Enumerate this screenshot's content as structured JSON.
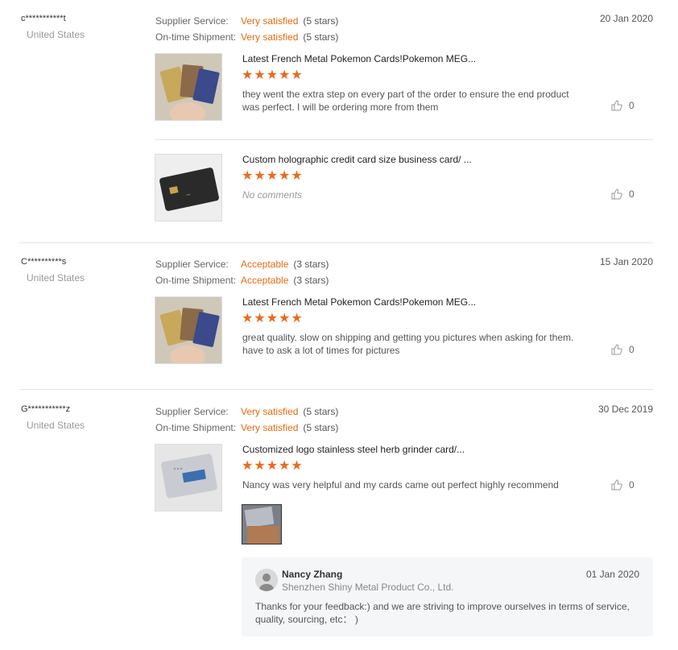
{
  "labels": {
    "supplier_service": "Supplier Service:",
    "on_time_shipment": "On-time Shipment:"
  },
  "reviews": [
    {
      "buyer": "c***********t",
      "country": "United States",
      "date": "20 Jan 2020",
      "supplier_service": {
        "level": "Very satisfied",
        "stars": "(5 stars)"
      },
      "on_time_shipment": {
        "level": "Very satisfied",
        "stars": "(5 stars)"
      },
      "items": [
        {
          "title": "Latest French Metal Pokemon Cards!Pokemon MEG...",
          "rating": 5,
          "stars": "★★★★★",
          "comment": "they went the extra step on every part of the order to ensure the end product was perfect. I will be ordering more from them",
          "likes": "0"
        },
        {
          "title": "Custom holographic credit card size business card/ ...",
          "rating": 5,
          "stars": "★★★★★",
          "comment": "No comments",
          "likes": "0"
        }
      ]
    },
    {
      "buyer": "C**********s",
      "country": "United States",
      "date": "15 Jan 2020",
      "supplier_service": {
        "level": "Acceptable",
        "stars": "(3 stars)"
      },
      "on_time_shipment": {
        "level": "Acceptable",
        "stars": "(3 stars)"
      },
      "items": [
        {
          "title": "Latest French Metal Pokemon Cards!Pokemon MEG...",
          "rating": 5,
          "stars": "★★★★★",
          "comment": "great quality.  slow on shipping and getting you pictures when asking for them. have to ask a lot of times for pictures",
          "likes": "0"
        }
      ]
    },
    {
      "buyer": "G***********z",
      "country": "United States",
      "date": "30 Dec 2019",
      "supplier_service": {
        "level": "Very satisfied",
        "stars": "(5 stars)"
      },
      "on_time_shipment": {
        "level": "Very satisfied",
        "stars": "(5 stars)"
      },
      "items": [
        {
          "title": "Customized logo stainless steel herb grinder card/...",
          "rating": 5,
          "stars": "★★★★★",
          "comment": "Nancy was very helpful and my cards came out perfect highly recommend",
          "likes": "0"
        }
      ],
      "reply": {
        "name": "Nancy Zhang",
        "company": "Shenzhen Shiny Metal Product Co., Ltd.",
        "date": "01 Jan 2020",
        "text": "Thanks for your feedback:) and we are striving to improve ourselves in terms of service, quality, sourcing, etc： )"
      }
    }
  ],
  "colors": {
    "accent": "#e56a12",
    "star": "#ea6a1e"
  }
}
